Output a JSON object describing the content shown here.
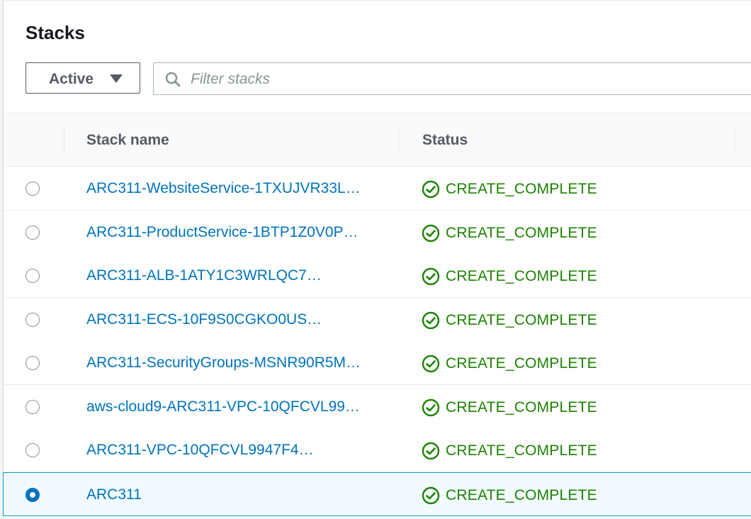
{
  "page": {
    "title": "Stacks"
  },
  "filter": {
    "selected": "Active",
    "placeholder": "Filter stacks"
  },
  "table": {
    "headers": {
      "stack_name": "Stack name",
      "status": "Status"
    },
    "rows": [
      {
        "name": "ARC311-WebsiteService-1TXUJVR33L…",
        "status": "CREATE_COMPLETE",
        "selected": false
      },
      {
        "name": "ARC311-ProductService-1BTP1Z0V0P…",
        "status": "CREATE_COMPLETE",
        "selected": false
      },
      {
        "name": "ARC311-ALB-1ATY1C3WRLQC7…",
        "status": "CREATE_COMPLETE",
        "selected": false
      },
      {
        "name": "ARC311-ECS-10F9S0CGKO0US…",
        "status": "CREATE_COMPLETE",
        "selected": false
      },
      {
        "name": "ARC311-SecurityGroups-MSNR90R5M…",
        "status": "CREATE_COMPLETE",
        "selected": false
      },
      {
        "name": "aws-cloud9-ARC311-VPC-10QFCVL99…",
        "status": "CREATE_COMPLETE",
        "selected": false
      },
      {
        "name": "ARC311-VPC-10QFCVL9947F4…",
        "status": "CREATE_COMPLETE",
        "selected": false
      },
      {
        "name": "ARC311",
        "status": "CREATE_COMPLETE",
        "selected": true
      }
    ]
  },
  "colors": {
    "link": "#0073bb",
    "success": "#1d8102",
    "selected_bg": "#f1faff",
    "selected_border": "#00a1c9"
  },
  "icons": {
    "search": "search-icon",
    "status": "check-circle-icon",
    "caret": "caret-down-icon"
  }
}
